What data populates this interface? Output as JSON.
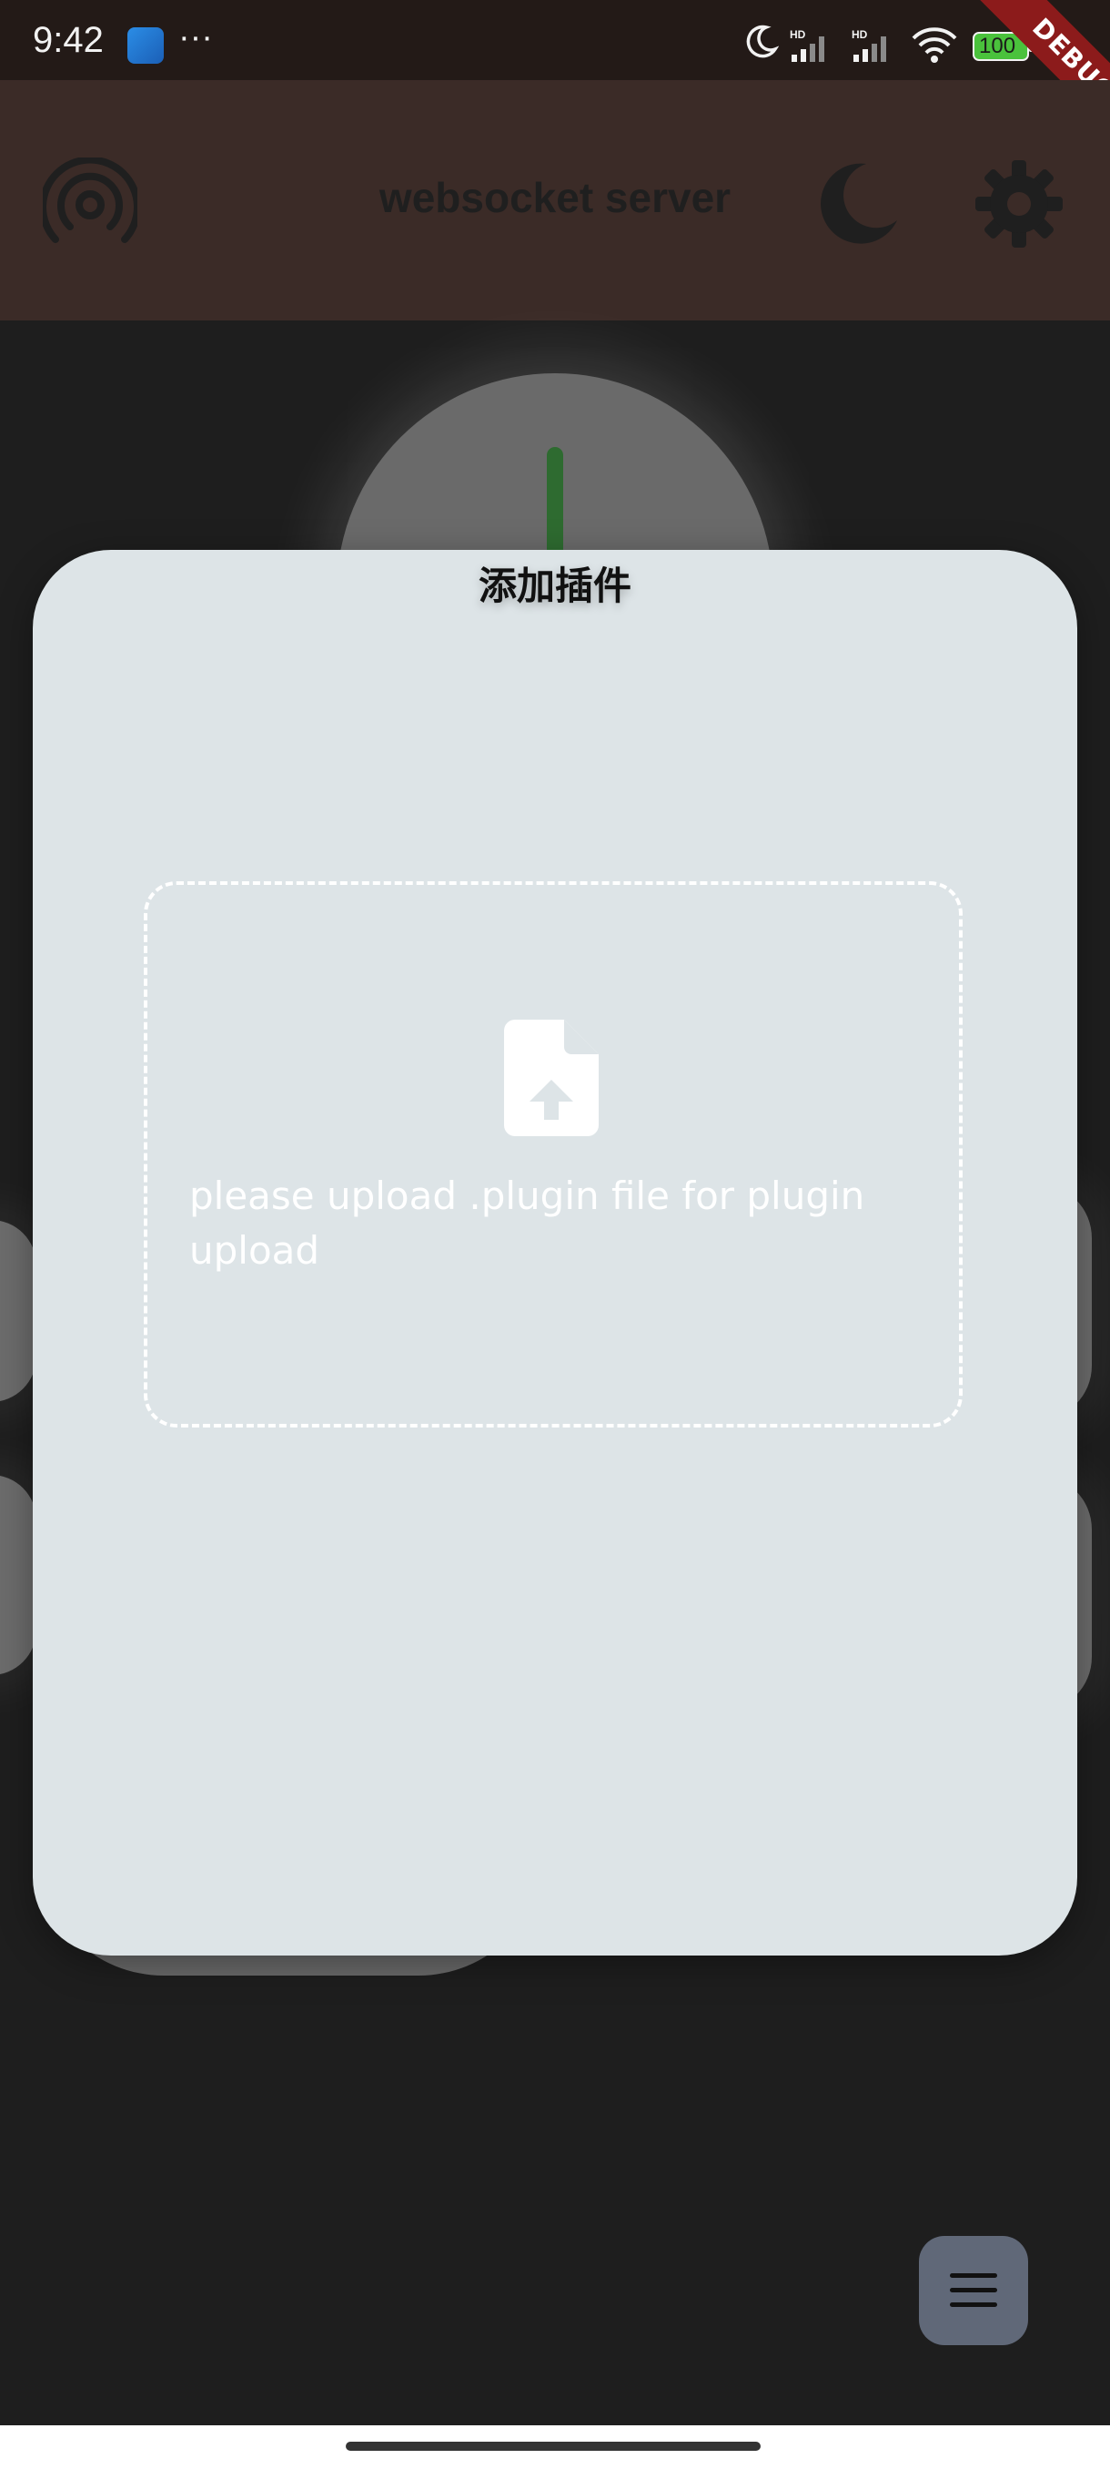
{
  "status_bar": {
    "time": "9:42",
    "more": "···",
    "battery": "100",
    "icons": [
      "app-icon",
      "moon-icon",
      "signal-hd-icon",
      "signal-hd-icon",
      "wifi-icon",
      "battery-icon"
    ]
  },
  "debug_banner": "DEBUG",
  "app_bar": {
    "title": "websocket server",
    "left_icon": "broadcast-icon",
    "right_icons": [
      "moon-icon",
      "gear-icon"
    ]
  },
  "dialog": {
    "title": "添加插件",
    "upload": {
      "icon": "file-upload-icon",
      "text": "please upload .plugin file for plugin upload"
    }
  },
  "fab": {
    "icon": "menu-icon"
  },
  "colors": {
    "dialog_bg": "#dde4e7",
    "app_bar_bg": "#3b2b27",
    "page_bg": "#1e1e1e",
    "power_icon": "#2e6b30",
    "fab_bg": "#606878",
    "debug_banner": "#8c1b1b"
  }
}
